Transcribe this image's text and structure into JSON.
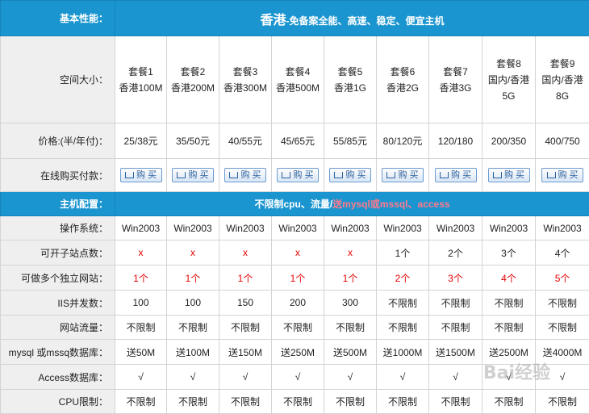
{
  "header": {
    "label": "基本性能：",
    "title_big": "香港",
    "title_small": "-免备案全能、高速、稳定、便宜主机"
  },
  "space": {
    "label": "空间大小：",
    "packages": [
      {
        "name": "套餐1",
        "spec": "香港100M"
      },
      {
        "name": "套餐2",
        "spec": "香港200M"
      },
      {
        "name": "套餐3",
        "spec": "香港300M"
      },
      {
        "name": "套餐4",
        "spec": "香港500M"
      },
      {
        "name": "套餐5",
        "spec": "香港1G"
      },
      {
        "name": "套餐6",
        "spec": "香港2G"
      },
      {
        "name": "套餐7",
        "spec": "香港3G"
      },
      {
        "name": "套餐8",
        "spec": "国内/香港5G"
      },
      {
        "name": "套餐9",
        "spec": "国内/香港8G"
      }
    ]
  },
  "price": {
    "label": "价格:(半/年付)：",
    "values": [
      "25/38元",
      "35/50元",
      "40/55元",
      "45/65元",
      "55/85元",
      "80/120元",
      "120/180",
      "200/350",
      "400/750"
    ]
  },
  "buy": {
    "label": "在线购买付款：",
    "button_label": "购 买"
  },
  "config": {
    "label": "主机配置：",
    "text_main": "不限制cpu、流量/",
    "text_highlight": "送mysql或mssql、access"
  },
  "rows": [
    {
      "label": "操作系统：",
      "values": [
        "Win2003",
        "Win2003",
        "Win2003",
        "Win2003",
        "Win2003",
        "Win2003",
        "Win2003",
        "Win2003",
        "Win2003"
      ]
    },
    {
      "label": "可开子站点数：",
      "values": [
        "x",
        "x",
        "x",
        "x",
        "x",
        "1个",
        "2个",
        "3个",
        "4个"
      ]
    },
    {
      "label": "可做多个独立网站：",
      "values": [
        "1个",
        "1个",
        "1个",
        "1个",
        "1个",
        "2个",
        "3个",
        "4个",
        "5个"
      ]
    },
    {
      "label": "IIS并发数：",
      "values": [
        "100",
        "100",
        "150",
        "200",
        "300",
        "不限制",
        "不限制",
        "不限制",
        "不限制"
      ]
    },
    {
      "label": "网站流量：",
      "values": [
        "不限制",
        "不限制",
        "不限制",
        "不限制",
        "不限制",
        "不限制",
        "不限制",
        "不限制",
        "不限制"
      ]
    },
    {
      "label": "mysql 或mssq数据库：",
      "values": [
        "送50M",
        "送100M",
        "送150M",
        "送250M",
        "送500M",
        "送1000M",
        "送1500M",
        "送2500M",
        "送4000M"
      ]
    },
    {
      "label": "Access数据库：",
      "values": [
        "√",
        "√",
        "√",
        "√",
        "√",
        "√",
        "√",
        "√",
        "√"
      ]
    },
    {
      "label": "CPU限制：",
      "values": [
        "不限制",
        "不限制",
        "不限制",
        "不限制",
        "不限制",
        "不限制",
        "不限制",
        "不限制",
        "不限制"
      ]
    }
  ],
  "watermark": "Bai经验"
}
